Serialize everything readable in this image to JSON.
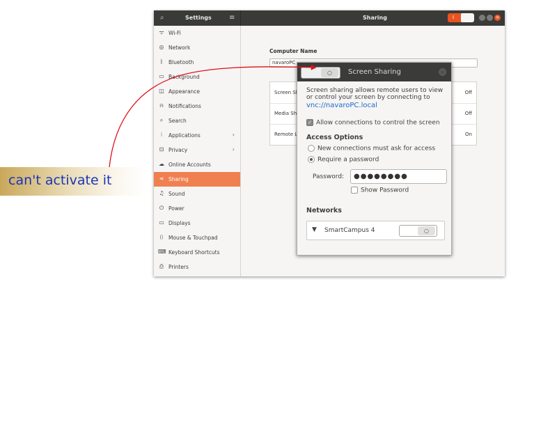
{
  "window": {
    "settings_title": "Settings",
    "panel_title": "Sharing"
  },
  "titlebar": {
    "sharing_toggle_label": "I"
  },
  "sidebar": {
    "items": [
      {
        "label": "Wi-Fi",
        "icon": "wifi-icon",
        "glyph": "ᯤ"
      },
      {
        "label": "Network",
        "icon": "network-icon",
        "glyph": "◎"
      },
      {
        "label": "Bluetooth",
        "icon": "bluetooth-icon",
        "glyph": "ᛒ"
      },
      {
        "label": "Background",
        "icon": "background-icon",
        "glyph": "▭"
      },
      {
        "label": "Appearance",
        "icon": "appearance-icon",
        "glyph": "◫"
      },
      {
        "label": "Notifications",
        "icon": "bell-icon",
        "glyph": "⍾"
      },
      {
        "label": "Search",
        "icon": "search-icon",
        "glyph": "⌕"
      },
      {
        "label": "Applications",
        "icon": "applications-icon",
        "glyph": "⁝",
        "chevron": "›"
      },
      {
        "label": "Privacy",
        "icon": "privacy-icon",
        "glyph": "⊡",
        "chevron": "›"
      },
      {
        "label": "Online Accounts",
        "icon": "cloud-icon",
        "glyph": "☁"
      },
      {
        "label": "Sharing",
        "icon": "share-icon",
        "glyph": "⋖",
        "active": true
      },
      {
        "label": "Sound",
        "icon": "music-icon",
        "glyph": "♫"
      },
      {
        "label": "Power",
        "icon": "power-icon",
        "glyph": "⏻"
      },
      {
        "label": "Displays",
        "icon": "display-icon",
        "glyph": "▭"
      },
      {
        "label": "Mouse & Touchpad",
        "icon": "mouse-icon",
        "glyph": "⌷"
      },
      {
        "label": "Keyboard Shortcuts",
        "icon": "keyboard-icon",
        "glyph": "⌨"
      },
      {
        "label": "Printers",
        "icon": "printer-icon",
        "glyph": "⎙"
      }
    ]
  },
  "sharing": {
    "computer_name_label": "Computer Name",
    "computer_name_value": "navaroPC",
    "rows": [
      {
        "label": "Screen Sh",
        "value": "Off"
      },
      {
        "label": "Media Sh",
        "value": "Off"
      },
      {
        "label": "Remote L",
        "value": "On"
      }
    ]
  },
  "dialog": {
    "title": "Screen Sharing",
    "description_line1": "Screen sharing allows remote users to view",
    "description_line2": "or control your screen by connecting to",
    "link": "vnc://navaroPC.local",
    "allow_control": "Allow connections to control the screen",
    "access_options": "Access Options",
    "option_ask": "New connections must ask for access",
    "option_password": "Require a password",
    "password_label": "Password:",
    "password_value": "●●●●●●●●",
    "show_password": "Show Password",
    "networks": "Networks",
    "network_name": "SmartCampus 4"
  },
  "annotation": {
    "text": "can't activate it"
  },
  "colors": {
    "accent": "#e95420",
    "sidebar_active": "#f08050",
    "link": "#1b6acb",
    "annotation_text": "#1a35b8",
    "arrow": "#e0101a"
  }
}
